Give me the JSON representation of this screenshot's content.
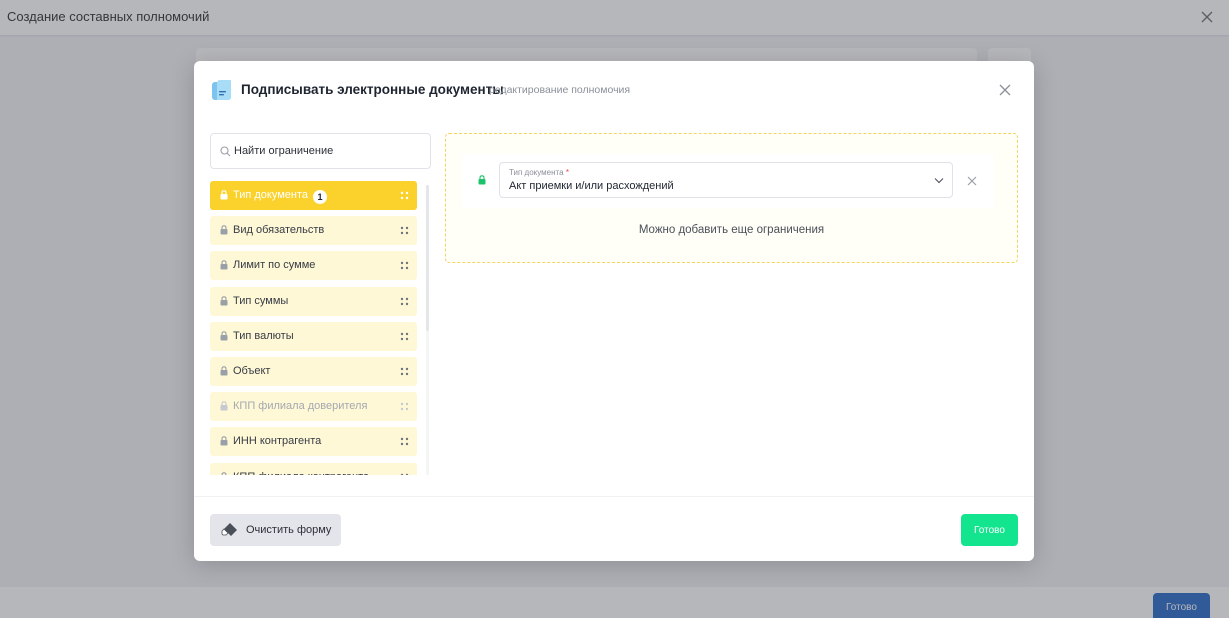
{
  "background": {
    "title": "Создание составных полномочий",
    "done_label": "Готово"
  },
  "modal": {
    "title": "Подписывать электронные документы",
    "subtitle": "редактирование полномочия",
    "search": {
      "placeholder": "Найти ограничение",
      "value": ""
    },
    "restrictions": [
      {
        "label": "Тип документа",
        "badge": "1",
        "active": true,
        "dim": false
      },
      {
        "label": "Вид обязательств",
        "active": false,
        "dim": false
      },
      {
        "label": "Лимит по сумме",
        "active": false,
        "dim": false
      },
      {
        "label": "Тип суммы",
        "active": false,
        "dim": false
      },
      {
        "label": "Тип валюты",
        "active": false,
        "dim": false
      },
      {
        "label": "Объект",
        "active": false,
        "dim": false
      },
      {
        "label": "КПП филиала доверителя",
        "active": false,
        "dim": true
      },
      {
        "label": "ИНН контрагента",
        "active": false,
        "dim": false
      },
      {
        "label": "КПП филиала контрагента",
        "active": false,
        "dim": false
      }
    ],
    "selected_restriction": {
      "field_label": "Тип документа",
      "required_mark": "*",
      "value": "Акт приемки и/или расхождений"
    },
    "hint": "Можно добавить еще ограничения",
    "clear_label": "Очистить форму",
    "done_label": "Готово"
  },
  "colors": {
    "active_item": "#fad22b",
    "item_bg": "#fff8d6",
    "done_green": "#13e58f",
    "bg_done_blue": "#1a5fc4",
    "lock_green": "#1ec26b"
  }
}
